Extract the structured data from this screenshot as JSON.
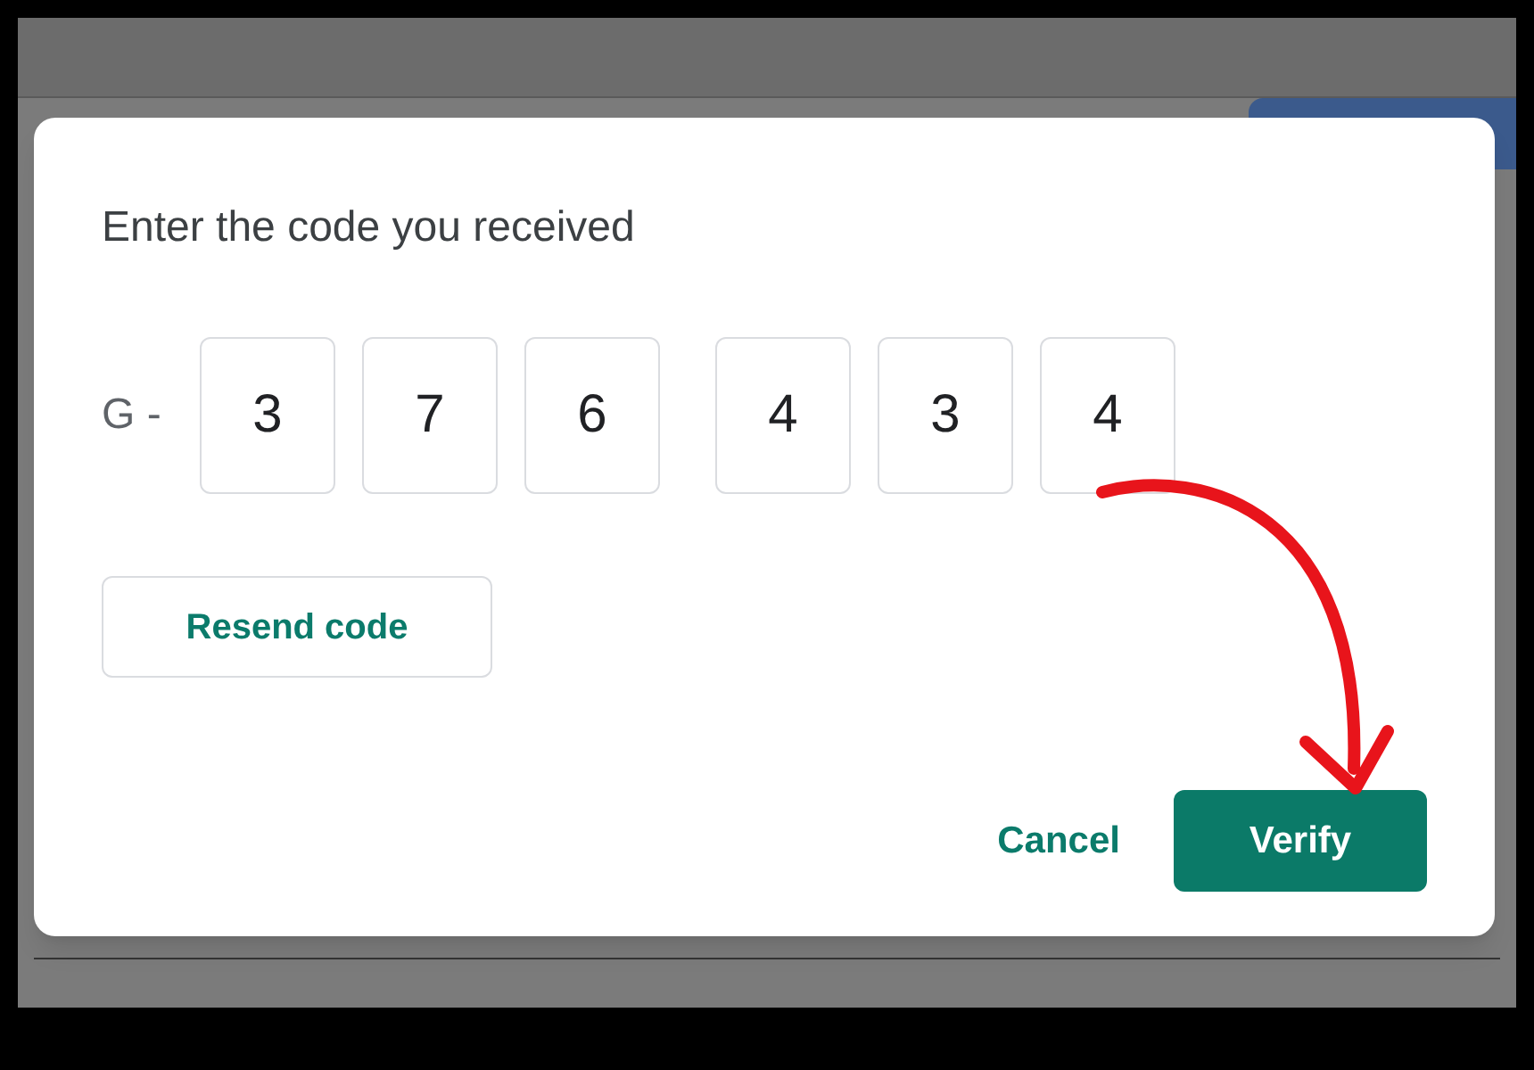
{
  "dialog": {
    "title": "Enter the code you received",
    "code_prefix": "G -",
    "digits": [
      "3",
      "7",
      "6",
      "4",
      "3",
      "4"
    ],
    "resend_button": "Resend code",
    "cancel_button": "Cancel",
    "verify_button": "Verify"
  }
}
